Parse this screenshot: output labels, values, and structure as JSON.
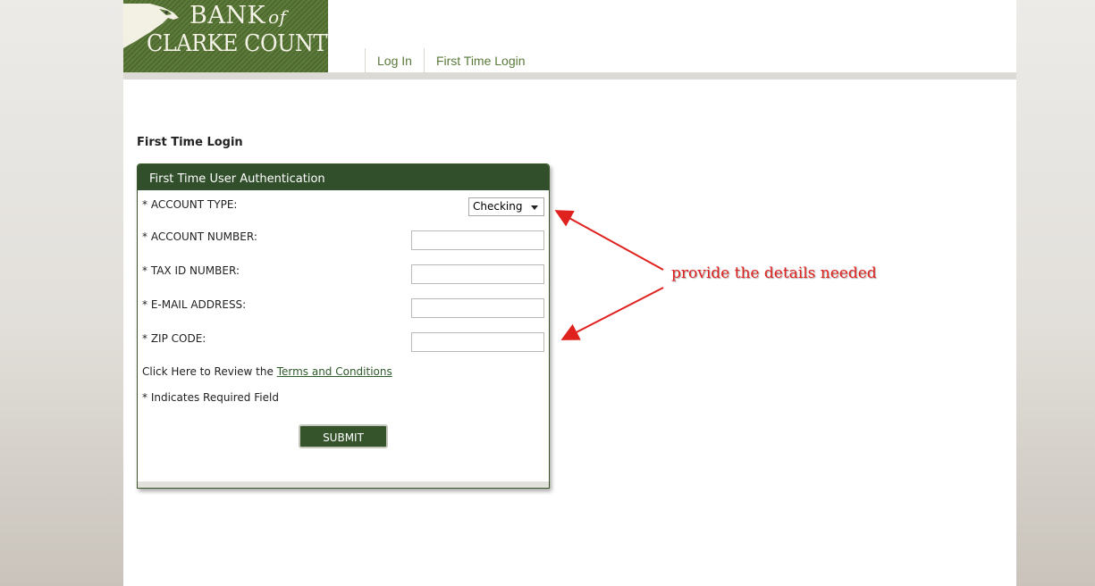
{
  "logo": {
    "line1": "BANK",
    "line1_of": "of",
    "line2": "CLARKE COUNTY",
    "icon": "eagle-icon"
  },
  "nav": {
    "items": [
      {
        "label": "Log In"
      },
      {
        "label": "First Time Login"
      }
    ]
  },
  "page": {
    "title": "First Time Login"
  },
  "panel": {
    "header": "First Time User Authentication",
    "fields": {
      "account_type": {
        "label": "* ACCOUNT TYPE:",
        "selected": "Checking"
      },
      "account_number": {
        "label": "* ACCOUNT NUMBER:",
        "value": ""
      },
      "tax_id": {
        "label": "* TAX ID NUMBER:",
        "value": ""
      },
      "email": {
        "label": "* E-MAIL ADDRESS:",
        "value": ""
      },
      "zip": {
        "label": "* ZIP CODE:",
        "value": ""
      }
    },
    "terms_prefix": "Click Here to Review the ",
    "terms_link": "Terms and Conditions",
    "required_note": "* Indicates Required Field",
    "submit_label": "SUBMIT"
  },
  "annotation": {
    "text": "provide the details needed",
    "color": "#e0221f"
  },
  "colors": {
    "brand_green": "#324f2b",
    "nav_green": "#5a7a3a"
  }
}
